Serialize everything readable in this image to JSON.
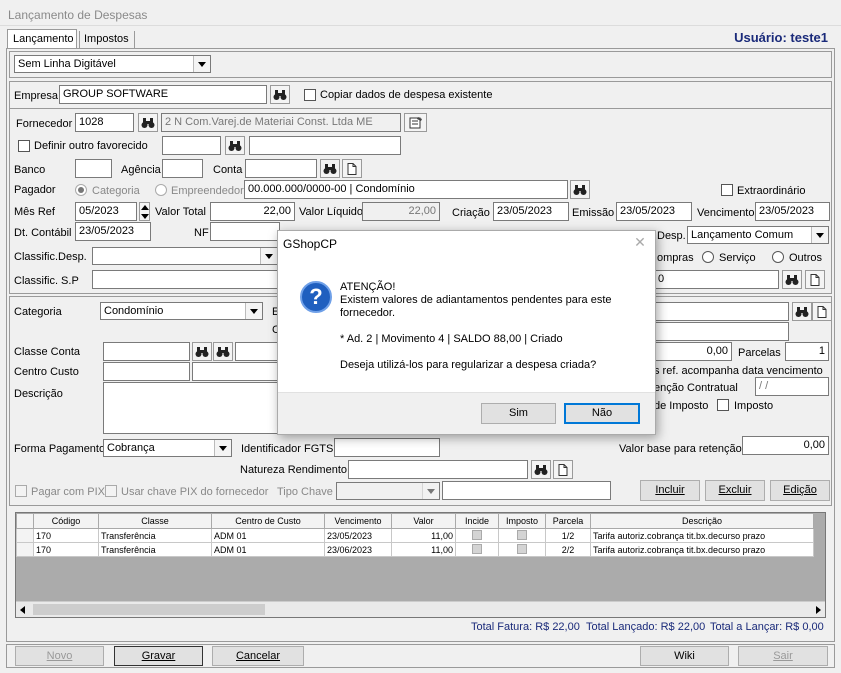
{
  "window": {
    "title": "Lançamento de Despesas",
    "user_label": "Usuário: teste1"
  },
  "tabs": [
    {
      "label": "Lançamento"
    },
    {
      "label": "Impostos"
    }
  ],
  "linha_digitavel": {
    "value": "Sem Linha Digitável"
  },
  "empresa": {
    "label": "Empresa",
    "value": "GROUP SOFTWARE",
    "copiar_label": "Copiar dados de despesa existente"
  },
  "fornecedor": {
    "label": "Fornecedor",
    "code": "1028",
    "name": "2 N Com.Varej.de Materiai Const. Ltda ME",
    "definir_label": "Definir outro favorecido"
  },
  "banco": {
    "banco_label": "Banco",
    "agencia_label": "Agência",
    "conta_label": "Conta"
  },
  "pagador": {
    "label": "Pagador",
    "opt_categoria": "Categoria",
    "opt_empreendedor": "Empreendedor",
    "value": "00.000.000/0000-00 | Condomínio",
    "extraordinario_label": "Extraordinário"
  },
  "valores": {
    "mes_ref_label": "Mês Ref",
    "mes_ref": "05/2023",
    "valor_total_label": "Valor Total",
    "valor_total": "22,00",
    "valor_liquido_label": "Valor Líquido",
    "valor_liquido": "22,00",
    "criacao_label": "Criação",
    "criacao": "23/05/2023",
    "emissao_label": "Emissão",
    "emissao": "23/05/2023",
    "vencimento_label": "Vencimento",
    "vencimento": "23/05/2023",
    "dt_contabil_label": "Dt. Contábil",
    "dt_contabil": "23/05/2023",
    "nf_label": "NF",
    "tipo_desp_label": "Desp.",
    "tipo_desp": "Lançamento Comum"
  },
  "classif": {
    "desp_label": "Classific.Desp.",
    "sp_label": "Classific. S.P",
    "compras_label": "ompras",
    "servico_label": "Serviço",
    "outros_label": "Outros",
    "sp_value": "0"
  },
  "categoria": {
    "label": "Categoria",
    "value": "Condomínio"
  },
  "classe_conta": {
    "label": "Classe Conta"
  },
  "centro_custo": {
    "label": "Centro Custo"
  },
  "descricao": {
    "label": "Descrição"
  },
  "parcelas": {
    "valor": "0,00",
    "label": "Parcelas",
    "value": "1"
  },
  "partial_labels": {
    "ref_acomp": "s ref. acompanha data vencimento",
    "retencao_contratual": "enção Contratual",
    "retencao_value": " / /",
    "de_imposto": "de Imposto",
    "imposto": "Imposto",
    "e_letter": "E",
    "c_letter": "C"
  },
  "forma_pagamento": {
    "label": "Forma Pagamento",
    "value": "Cobrança"
  },
  "fgts": {
    "label": "Identificador FGTS"
  },
  "natureza": {
    "label": "Natureza Rendimento"
  },
  "retencao": {
    "label": "Valor base para retenção",
    "value": "0,00"
  },
  "pix": {
    "pagar_label": "Pagar com PIX",
    "usar_label": "Usar chave PIX do fornecedor",
    "tipo_label": "Tipo Chave"
  },
  "actions": {
    "incluir": "Incluir",
    "excluir": "Excluir",
    "edicao": "Edição"
  },
  "grid": {
    "columns": [
      "Código",
      "Classe",
      "Centro de Custo",
      "Vencimento",
      "Valor",
      "Incide",
      "Imposto",
      "Parcela",
      "Descrição"
    ],
    "rows": [
      [
        "170",
        "Transferência",
        "ADM 01",
        "23/05/2023",
        "11,00",
        "",
        "",
        "1/2",
        "Tarifa autoriz.cobrança tit.bx.decurso prazo"
      ],
      [
        "170",
        "Transferência",
        "ADM 01",
        "23/06/2023",
        "11,00",
        "",
        "",
        "2/2",
        "Tarifa autoriz.cobrança tit.bx.decurso prazo"
      ]
    ]
  },
  "totals": {
    "fatura": "Total Fatura: R$ 22,00",
    "lancado": "Total Lançado: R$ 22,00",
    "a_lancar": "Total a Lançar: R$ 0,00"
  },
  "footer": {
    "novo": "Novo",
    "gravar": "Gravar",
    "cancelar": "Cancelar",
    "wiki": "Wiki",
    "sair": "Sair"
  },
  "dialog": {
    "title": "GShopCP",
    "line1": "ATENÇÃO!",
    "line2": "Existem valores de adiantamentos pendentes para este fornecedor.",
    "line3": "* Ad. 2 | Movimento 4 | SALDO 88,00 |  Criado",
    "line4": "Deseja utilizá-los para regularizar a despesa criada?",
    "sim": "Sim",
    "nao": "Não"
  },
  "colors": {
    "user_label": "#1a2a7a",
    "totals": "#1a2a7a",
    "dialog_icon": "#1f5fbf"
  }
}
